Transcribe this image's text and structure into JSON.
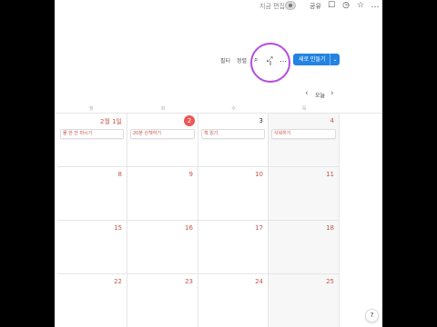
{
  "topbar": {
    "edit_status": "지금 편집",
    "share_label": "공유",
    "icons": [
      "comment-icon",
      "clock-icon",
      "star-icon",
      "more-icon"
    ],
    "icon_glyphs": [
      "☐",
      "◷",
      "☆",
      "…"
    ]
  },
  "toolbar": {
    "filter_label": "필터",
    "sort_label": "정렬",
    "search_glyph": "⌕",
    "expand_glyph": "⤢",
    "more_glyph": "…",
    "new_button_label": "새로 만들기",
    "new_button_caret": "⌄"
  },
  "navigation": {
    "prev_glyph": "‹",
    "next_glyph": "›",
    "today_label": "오늘"
  },
  "weekdays": [
    "월",
    "화",
    "수",
    "목"
  ],
  "colors": {
    "accent": "#2383e2",
    "today_badge": "#eb5757",
    "event_text": "#c4554d",
    "highlight_ring": "#b44be0"
  },
  "weeks": [
    [
      {
        "day": "2월 1일",
        "event": "물 한 잔 마시기"
      },
      {
        "day": "2",
        "today": true,
        "event": "20분 산책하기"
      },
      {
        "day": "3",
        "event": "책 읽기"
      },
      {
        "day": "4",
        "weekend": true,
        "event": "샤워하기"
      }
    ],
    [
      {
        "day": "8"
      },
      {
        "day": "9"
      },
      {
        "day": "10"
      },
      {
        "day": "11",
        "weekend": true
      }
    ],
    [
      {
        "day": "15"
      },
      {
        "day": "16"
      },
      {
        "day": "17"
      },
      {
        "day": "18",
        "weekend": true
      }
    ],
    [
      {
        "day": "22"
      },
      {
        "day": "23"
      },
      {
        "day": "24"
      },
      {
        "day": "25",
        "weekend": true
      }
    ]
  ],
  "help_label": "?"
}
